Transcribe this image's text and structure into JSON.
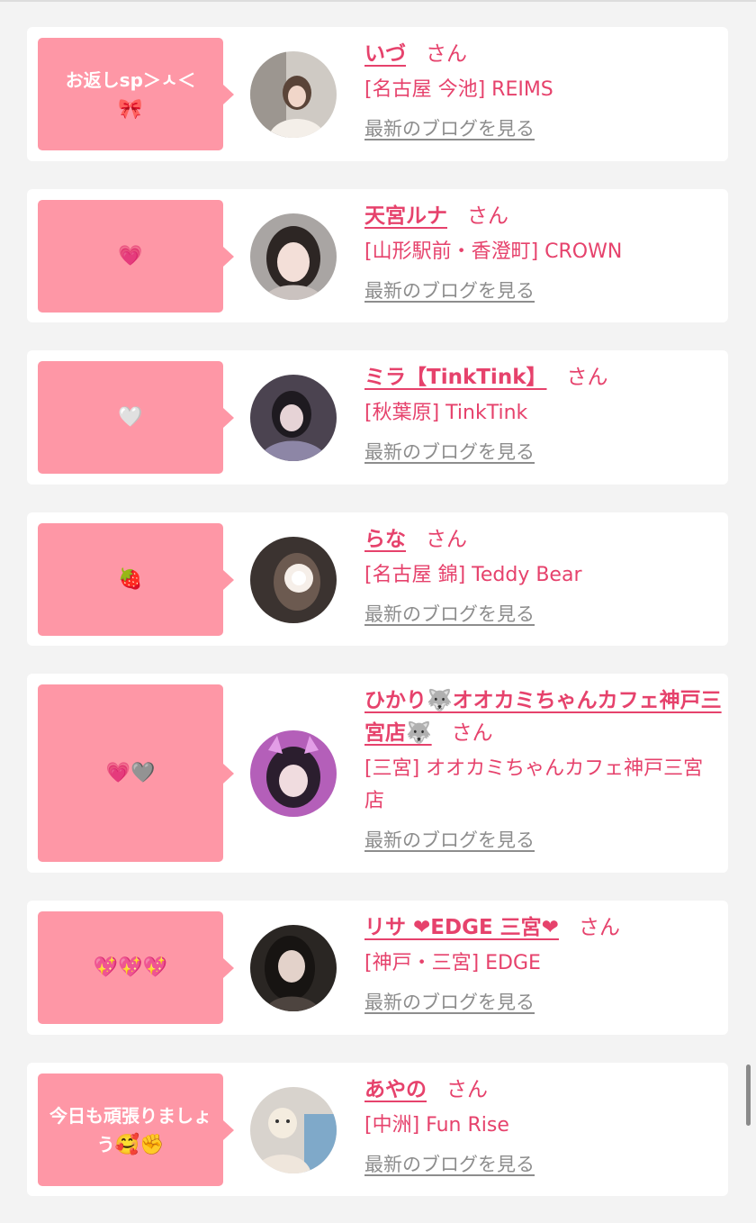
{
  "blog_link_label": "最新のブログを見る",
  "honorific": "さん",
  "colors": {
    "accent": "#e6426c",
    "bubble": "#fe97a6",
    "link_gray": "#8d8d8d",
    "background": "#f3f3f3"
  },
  "items": [
    {
      "message": "お返しsp＞ㅅ＜",
      "message_emoji": "🎀",
      "name": "いづ",
      "shop": "[名古屋 今池] REIMS"
    },
    {
      "message": "",
      "message_emoji": "💗",
      "name": "天宮ルナ",
      "shop": "[山形駅前・香澄町] CROWN"
    },
    {
      "message": "",
      "message_emoji": "🤍",
      "name": "ミラ【TinkTink】",
      "shop": "[秋葉原] TinkTink"
    },
    {
      "message": "",
      "message_emoji": "🍓",
      "name": "らな",
      "shop": "[名古屋 錦] Teddy Bear"
    },
    {
      "message": "",
      "message_emoji": "💗🩶",
      "name": "ひかり🐺オオカミちゃんカフェ神戸三宮店🐺",
      "shop": "[三宮] オオカミちゃんカフェ神戸三宮店"
    },
    {
      "message": "",
      "message_emoji": "💖💖💖",
      "name": "リサ ❤EDGE 三宮❤",
      "shop": "[神戸・三宮] EDGE"
    },
    {
      "message": "今日も頑張りましょう",
      "message_emoji": "🥰✊",
      "name": "あやの",
      "shop": "[中洲] Fun Rise"
    }
  ]
}
